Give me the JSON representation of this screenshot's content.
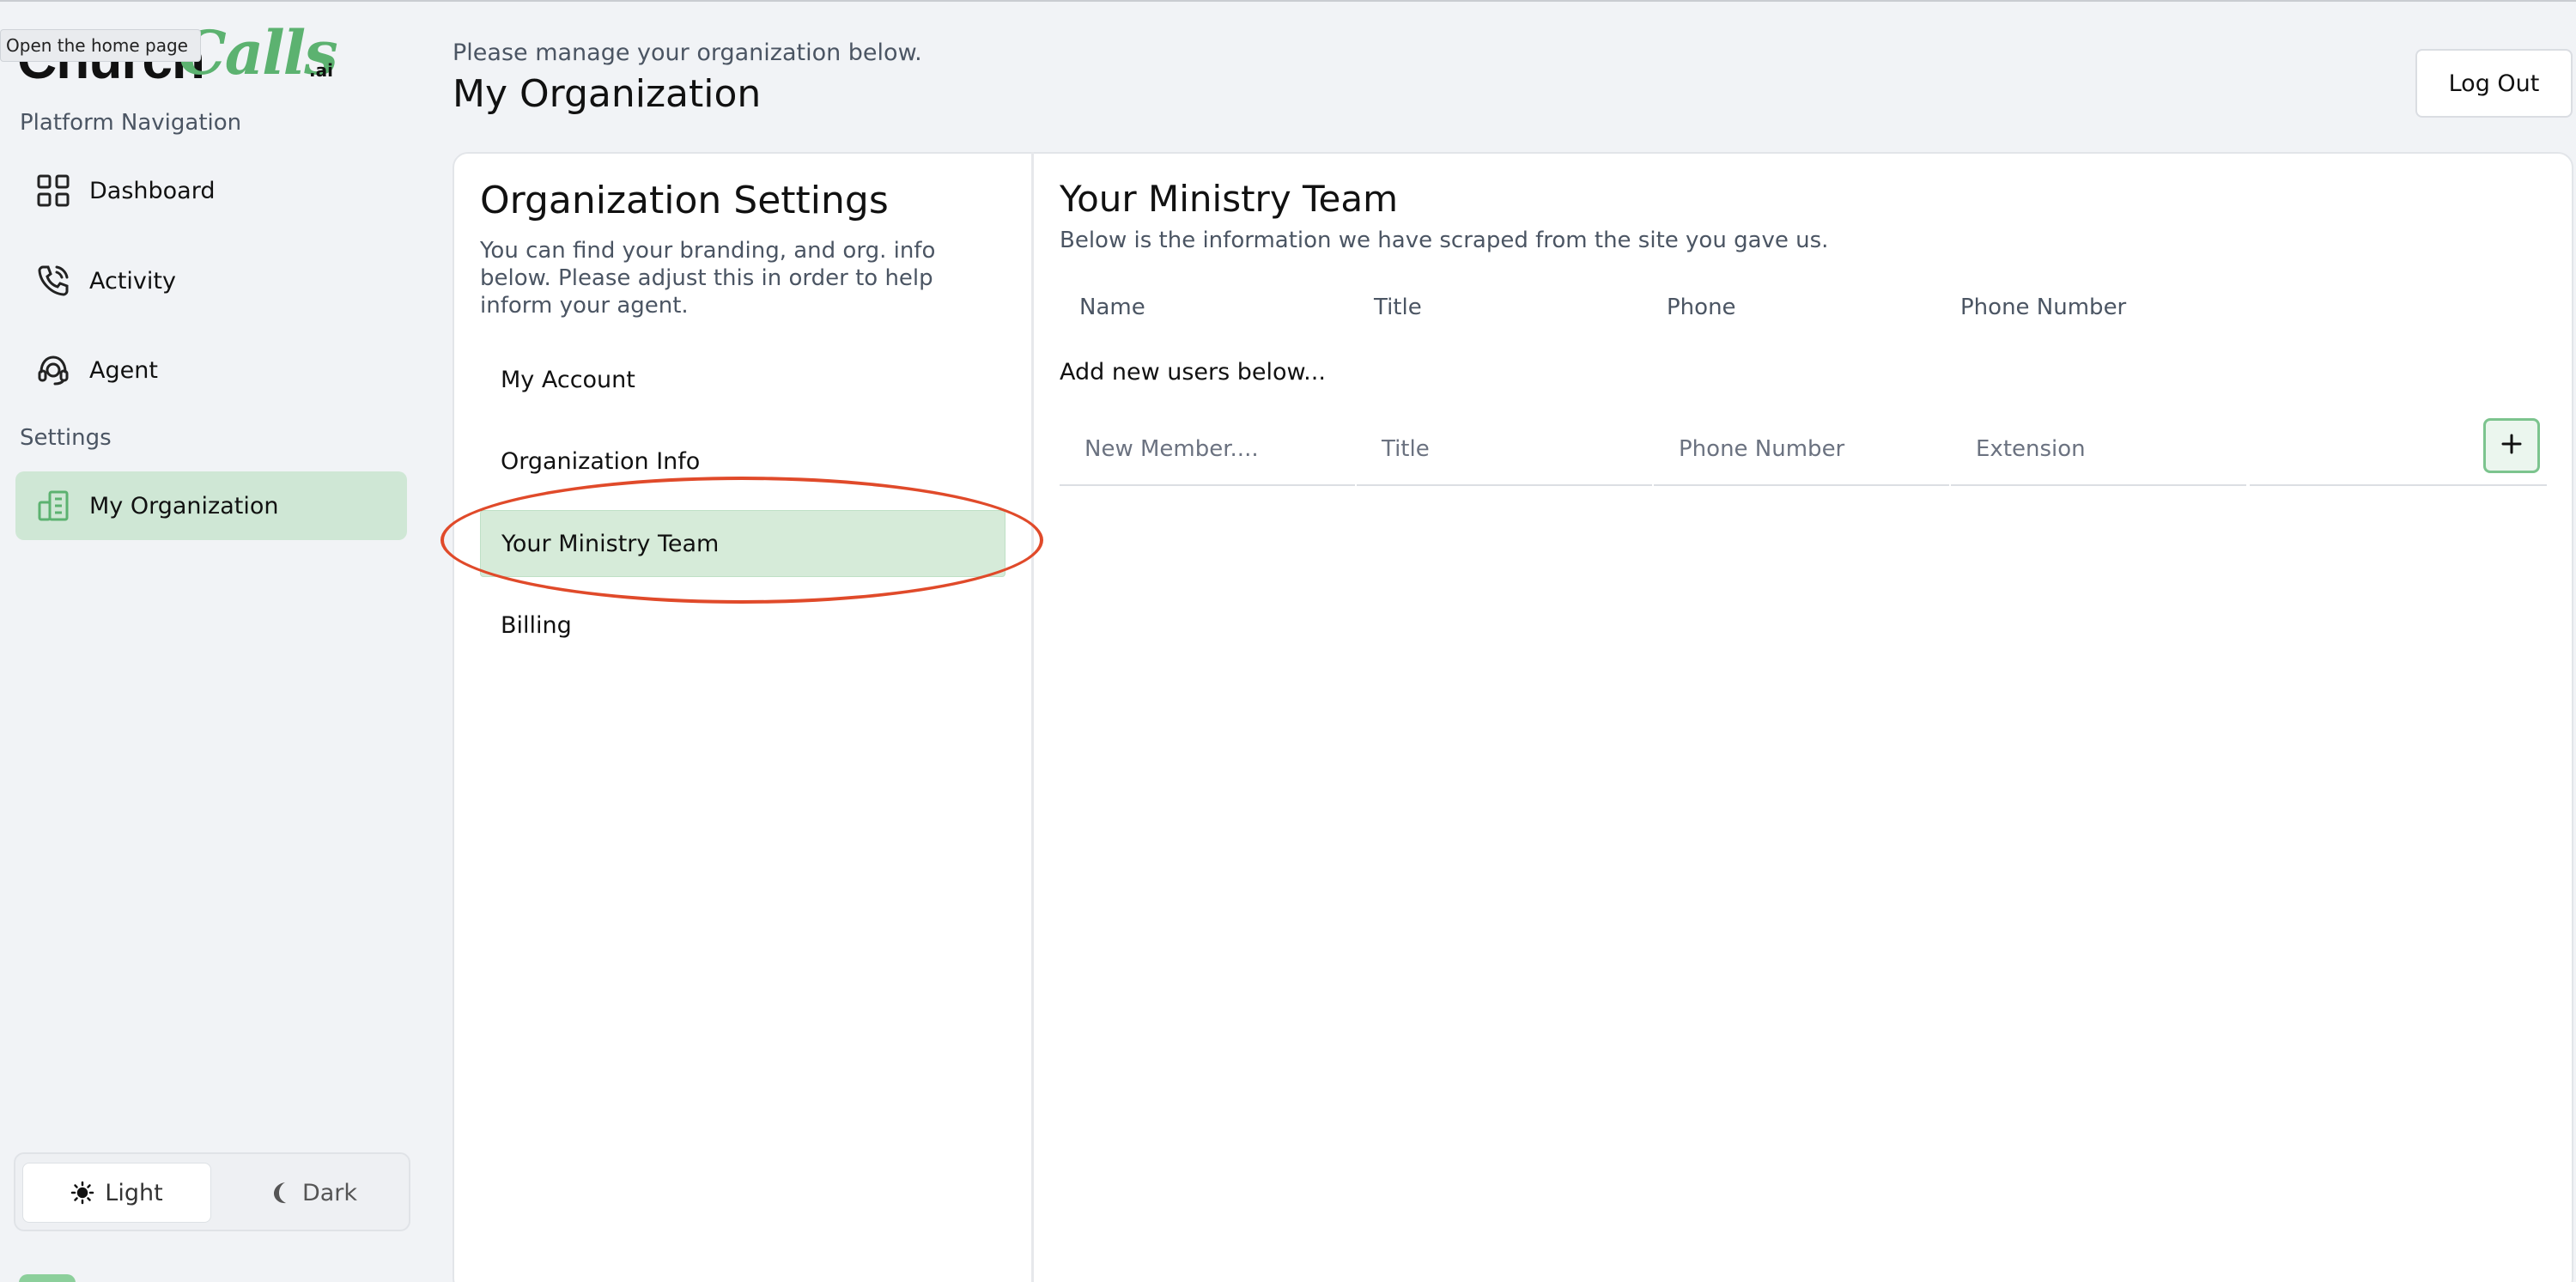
{
  "brand": {
    "name_part1": "Church",
    "name_part2": "Calls",
    "suffix": ".ai"
  },
  "tooltip": "Open the home page",
  "sidebar": {
    "platform_label": "Platform Navigation",
    "settings_label": "Settings",
    "nav": [
      {
        "label": "Dashboard",
        "icon": "grid-icon"
      },
      {
        "label": "Activity",
        "icon": "phone-call-icon"
      },
      {
        "label": "Agent",
        "icon": "headset-icon"
      }
    ],
    "settings_items": [
      {
        "label": "My Organization",
        "icon": "building-icon",
        "active": true
      }
    ],
    "theme": {
      "light": "Light",
      "dark": "Dark",
      "selected": "Light"
    }
  },
  "header": {
    "subtitle": "Please manage your organization below.",
    "title": "My Organization",
    "logout": "Log Out"
  },
  "settings_panel": {
    "title": "Organization Settings",
    "description": "You can find your branding, and org. info below. Please adjust this in order to help inform your agent.",
    "items": [
      "My Account",
      "Organization Info",
      "Your Ministry Team",
      "Billing"
    ],
    "active": "Your Ministry Team"
  },
  "team": {
    "title": "Your Ministry Team",
    "description": "Below is the information we have scraped from the site you gave us.",
    "columns": [
      "Name",
      "Title",
      "Phone",
      "Phone Number"
    ],
    "add_label": "Add new users below...",
    "new_member": {
      "name_placeholder": "New Member....",
      "title_placeholder": "Title",
      "phone_placeholder": "Phone Number",
      "extension_placeholder": "Extension"
    }
  },
  "colors": {
    "accent": "#5cb270",
    "active_bg": "#cfe7d5",
    "highlight": "#e04a2a"
  }
}
